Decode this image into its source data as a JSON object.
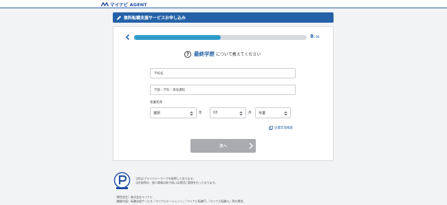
{
  "brand": {
    "logo_text": "マイナビ AGENT"
  },
  "header": {
    "title": "無料転職支援サービスお申し込み"
  },
  "progress": {
    "current_step": "8",
    "total": "/ 06",
    "fraction": 0.5
  },
  "question": {
    "highlight": "最終学歴",
    "rest": "について教えてください",
    "icon": "?"
  },
  "form": {
    "school_placeholder": "学校名",
    "faculty_placeholder": "学部・学科・専攻課程",
    "graduation_label": "卒業年月",
    "year_value": "選択",
    "year_unit": "年",
    "month_value": "03",
    "month_unit": "月",
    "status_value": "卒業"
  },
  "link": {
    "label": "企業年収検索"
  },
  "next_button": {
    "label": "次へ"
  },
  "privacy": {
    "line1": "当社はプライバシーマークを取得しております。",
    "line2": "当社取得の、個人情報の取り扱いは適切に管理を行っております。"
  },
  "footer": {
    "line1": "（運営会社）株式会社マイナビ",
    "line2": "（職業内容）転職支援サービス「マイナビエージェント」「マイナビ転職IT」「マイナビ転職エ」等の運営。"
  },
  "colors": {
    "primary": "#2461a8",
    "progress": "#2f9bc9",
    "button_disabled": "#a9abae"
  }
}
